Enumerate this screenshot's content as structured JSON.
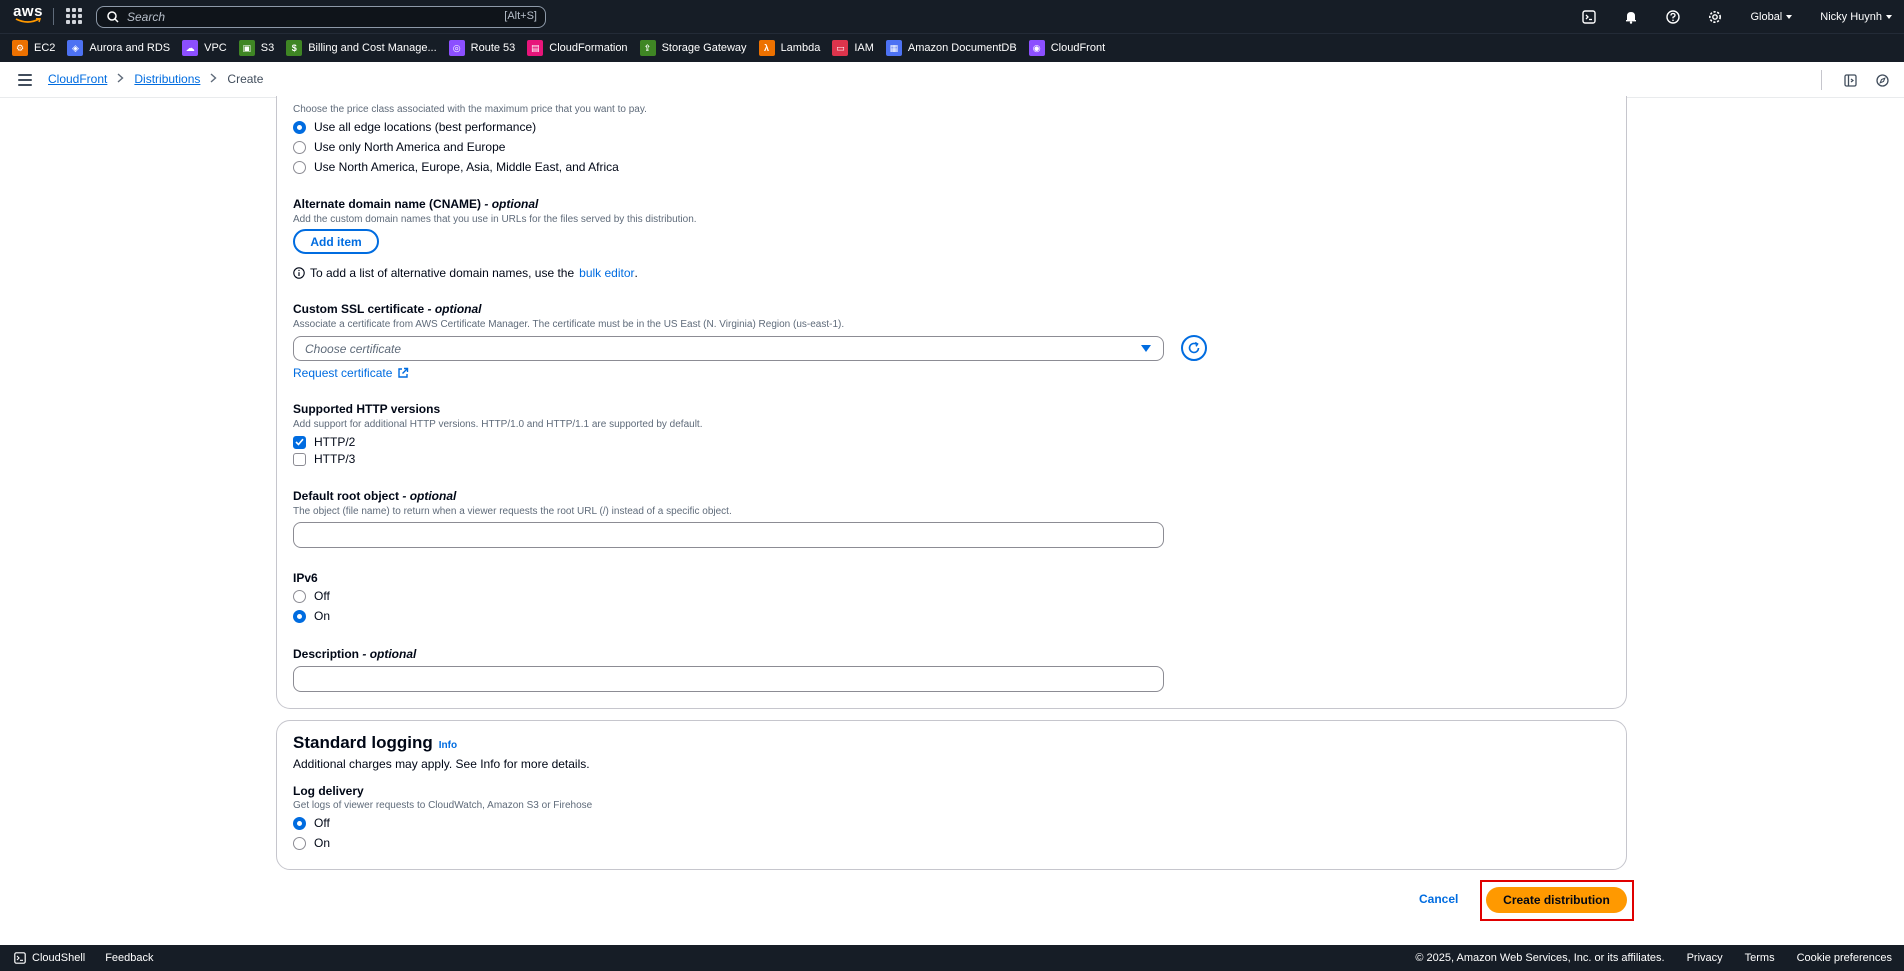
{
  "topnav": {
    "logo_text": "aws",
    "search_placeholder": "Search",
    "search_shortcut": "[Alt+S]",
    "region": "Global",
    "user": "Nicky Huynh"
  },
  "favorites": [
    {
      "label": "EC2",
      "color": "#ed7100",
      "glyph": "⚙"
    },
    {
      "label": "Aurora and RDS",
      "color": "#4d72f3",
      "glyph": "◈"
    },
    {
      "label": "VPC",
      "color": "#8c4fff",
      "glyph": "☁"
    },
    {
      "label": "S3",
      "color": "#3f8624",
      "glyph": "▣"
    },
    {
      "label": "Billing and Cost Manage...",
      "color": "#3f8624",
      "glyph": "$"
    },
    {
      "label": "Route 53",
      "color": "#8c4fff",
      "glyph": "◎"
    },
    {
      "label": "CloudFormation",
      "color": "#e7157b",
      "glyph": "▤"
    },
    {
      "label": "Storage Gateway",
      "color": "#3f8624",
      "glyph": "⇪"
    },
    {
      "label": "Lambda",
      "color": "#ed7100",
      "glyph": "λ"
    },
    {
      "label": "IAM",
      "color": "#dd344c",
      "glyph": "▭"
    },
    {
      "label": "Amazon DocumentDB",
      "color": "#4d72f3",
      "glyph": "▦"
    },
    {
      "label": "CloudFront",
      "color": "#8c4fff",
      "glyph": "◉"
    }
  ],
  "breadcrumb": {
    "root": "CloudFront",
    "section": "Distributions",
    "current": "Create"
  },
  "price_class": {
    "description": "Choose the price class associated with the maximum price that you want to pay.",
    "options": [
      {
        "label": "Use all edge locations (best performance)",
        "selected": true
      },
      {
        "label": "Use only North America and Europe",
        "selected": false
      },
      {
        "label": "Use North America, Europe, Asia, Middle East, and Africa",
        "selected": false
      }
    ]
  },
  "cname": {
    "label": "Alternate domain name (CNAME)",
    "optional": "- optional",
    "description": "Add the custom domain names that you use in URLs for the files served by this distribution.",
    "add_button": "Add item",
    "hint_prefix": "To add a list of alternative domain names, use the",
    "hint_link": "bulk editor",
    "hint_suffix": "."
  },
  "ssl": {
    "label": "Custom SSL certificate",
    "optional": "- optional",
    "description": "Associate a certificate from AWS Certificate Manager. The certificate must be in the US East (N. Virginia) Region (us-east-1).",
    "placeholder": "Choose certificate",
    "request_link": "Request certificate"
  },
  "http_versions": {
    "label": "Supported HTTP versions",
    "description": "Add support for additional HTTP versions. HTTP/1.0 and HTTP/1.1 are supported by default.",
    "options": [
      {
        "label": "HTTP/2",
        "checked": true
      },
      {
        "label": "HTTP/3",
        "checked": false
      }
    ]
  },
  "root_object": {
    "label": "Default root object",
    "optional": "- optional",
    "description": "The object (file name) to return when a viewer requests the root URL (/) instead of a specific object.",
    "value": ""
  },
  "ipv6": {
    "label": "IPv6",
    "options": [
      {
        "label": "Off",
        "selected": false
      },
      {
        "label": "On",
        "selected": true
      }
    ]
  },
  "description_field": {
    "label": "Description",
    "optional": "- optional",
    "value": ""
  },
  "logging": {
    "title": "Standard logging",
    "info": "Info",
    "subtitle": "Additional charges may apply. See Info for more details.",
    "delivery_label": "Log delivery",
    "delivery_description": "Get logs of viewer requests to CloudWatch, Amazon S3 or Firehose",
    "options": [
      {
        "label": "Off",
        "selected": true
      },
      {
        "label": "On",
        "selected": false
      }
    ]
  },
  "actions": {
    "cancel": "Cancel",
    "create": "Create distribution"
  },
  "footer": {
    "cloudshell": "CloudShell",
    "feedback": "Feedback",
    "copyright": "© 2025, Amazon Web Services, Inc. or its affiliates.",
    "privacy": "Privacy",
    "terms": "Terms",
    "cookies": "Cookie preferences"
  },
  "colors": {
    "nav_bg": "#161d26",
    "link": "#006ce0",
    "primary": "#ff9900",
    "highlight": "#e00000"
  }
}
